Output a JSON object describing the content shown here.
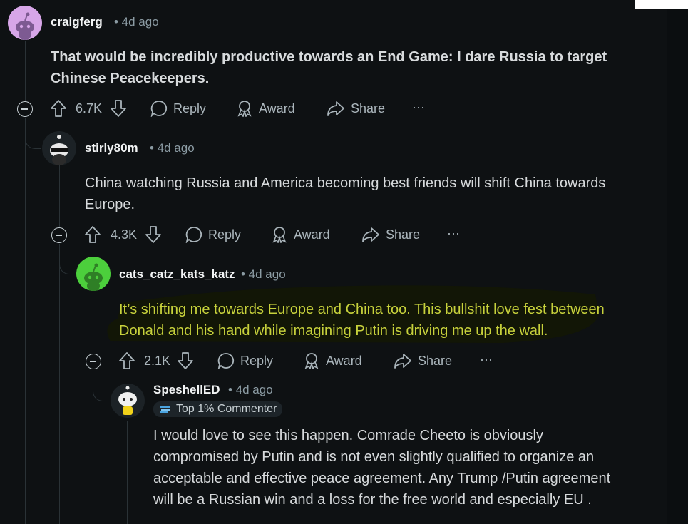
{
  "comments": [
    {
      "username": "craigferg",
      "time": "• 4d ago",
      "body_lines": [
        "That would be incredibly productive towards an End Game: I dare Russia to target",
        "Chinese Peacekeepers."
      ],
      "votes": "6.7K"
    },
    {
      "username": "stirly80m",
      "time": "• 4d ago",
      "body_lines": [
        "China watching Russia and America becoming best friends will shift China towards",
        "Europe."
      ],
      "votes": "4.3K"
    },
    {
      "username": "cats_catz_kats_katz",
      "time": "• 4d ago",
      "body_lines": [
        "It’s shifting me towards Europe and China too. This bullshit love fest between",
        "Donald and his hand while imagining Putin is driving me up the wall."
      ],
      "votes": "2.1K"
    },
    {
      "username": "SpeshellED",
      "time": "• 4d ago",
      "flair": "Top 1% Commenter",
      "body_lines": [
        "I would love to see this happen. Comrade Cheeto is obviously",
        "compromised by Putin and is not even slightly qualified to organize an",
        "acceptable and effective peace agreement. Any Trump /Putin agreement",
        "will be a Russian win and a loss for the free world and especially EU ."
      ]
    }
  ],
  "actions": {
    "reply": "Reply",
    "award": "Award",
    "share": "Share",
    "more": "···"
  },
  "colors": {
    "background": "#0e1113",
    "highlight_text": "#c8d23c",
    "highlight_bg": "#121606"
  }
}
